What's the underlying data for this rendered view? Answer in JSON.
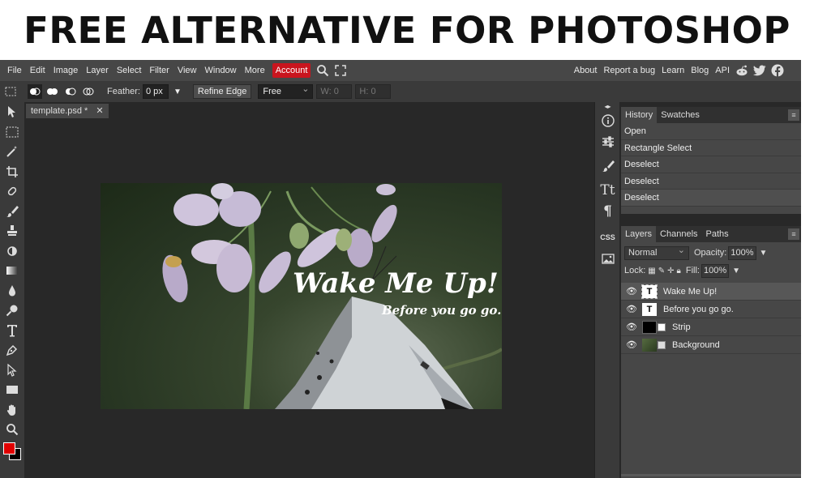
{
  "headline": "FREE ALTERNATIVE FOR PHOTOSHOP",
  "menu": {
    "items": [
      "File",
      "Edit",
      "Image",
      "Layer",
      "Select",
      "Filter",
      "View",
      "Window",
      "More"
    ],
    "account": "Account",
    "right_items": [
      "About",
      "Report a bug",
      "Learn",
      "Blog",
      "API"
    ],
    "social_icons": [
      "reddit-icon",
      "twitter-icon",
      "facebook-icon"
    ]
  },
  "options": {
    "feather_label": "Feather:",
    "feather_value": "0 px",
    "refine_edge": "Refine Edge",
    "style_value": "Free",
    "w_label": "W:",
    "w_value": "0",
    "h_label": "H:",
    "h_value": "0"
  },
  "document": {
    "tab_label": "template.psd *",
    "close": "✕",
    "canvas_title": "Wake Me Up!",
    "canvas_subtitle": "Before you go go."
  },
  "history_panel": {
    "tabs": [
      "History",
      "Swatches"
    ],
    "entries": [
      "Open",
      "Rectangle Select",
      "Deselect",
      "Deselect",
      "Deselect"
    ]
  },
  "layers_panel": {
    "tabs": [
      "Layers",
      "Channels",
      "Paths"
    ],
    "blend_mode": "Normal",
    "opacity_label": "Opacity:",
    "opacity_value": "100%",
    "lock_label": "Lock:",
    "fill_label": "Fill:",
    "fill_value": "100%",
    "layers": [
      {
        "name": "Wake Me Up!",
        "type": "text",
        "thumb": "T"
      },
      {
        "name": "Before you go go.",
        "type": "text",
        "thumb": "T"
      },
      {
        "name": "Strip",
        "type": "strip"
      },
      {
        "name": "Background",
        "type": "image"
      }
    ]
  },
  "side_icons": [
    "info-icon",
    "adjustments-icon",
    "brush-settings-icon",
    "character-icon",
    "paragraph-icon",
    "css-icon",
    "image-icon"
  ],
  "side_labels": {
    "css": "CSS",
    "char": "Tt",
    "para": "¶"
  },
  "colors": {
    "accent": "#c9151e",
    "foreground": "#e00000",
    "background_color": "#000000"
  }
}
